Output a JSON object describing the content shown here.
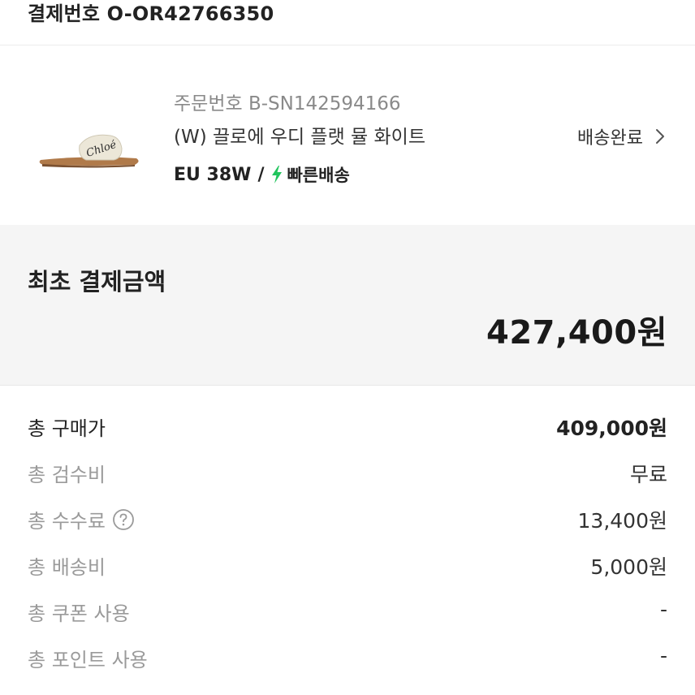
{
  "payment_header": {
    "label": "결제번호 O-OR42766350"
  },
  "order_item": {
    "order_number": "주문번호 B-SN142594166",
    "product_name": "(W) 끌로에 우디 플랫 뮬 화이트",
    "size": "EU 38W",
    "separator": "/",
    "fast_delivery": "빠른배송",
    "status": "배송완료",
    "thumbnail_text": "Chloé",
    "accent_color": "#22c55e"
  },
  "initial_payment": {
    "title": "최초 결제금액",
    "amount": "427,400원"
  },
  "breakdown": [
    {
      "label": "총 구매가",
      "value": "409,000원"
    },
    {
      "label": "총 검수비",
      "value": "무료"
    },
    {
      "label": "총 수수료",
      "value": "13,400원"
    },
    {
      "label": "총 배송비",
      "value": "5,000원"
    },
    {
      "label": "총 쿠폰 사용",
      "value": "-"
    },
    {
      "label": "총 포인트 사용",
      "value": "-"
    }
  ]
}
